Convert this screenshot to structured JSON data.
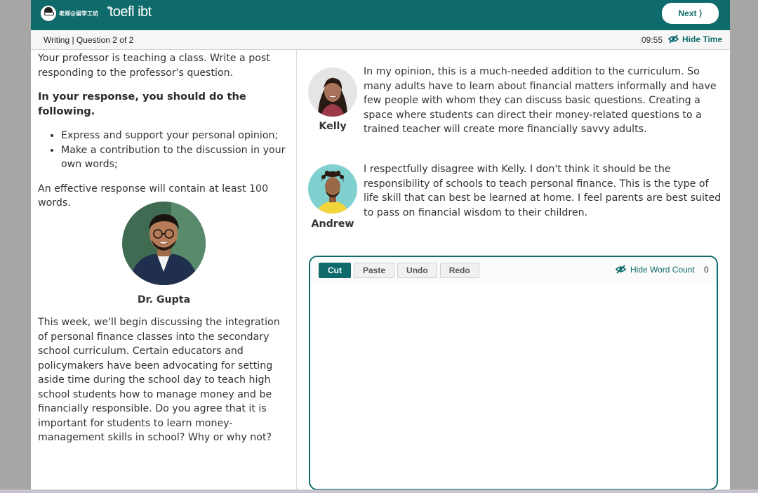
{
  "header": {
    "brand_text": "老郑@留学工坊",
    "logo_text": "toefl ibt",
    "next_label": "Next ⟩"
  },
  "subheader": {
    "section": "Writing | Question 2 of 2",
    "timer": "09:55",
    "hide_time_label": "Hide Time"
  },
  "prompt": {
    "intro": "Your professor is teaching a class. Write a post responding to the professor's question.",
    "requirements_heading": "In your response, you should do the following.",
    "requirements": [
      "Express and support your personal opinion;",
      "Make a contribution to the discussion in your own words;"
    ],
    "min_words": "An effective response will contain at least 100 words.",
    "professor_name": "Dr. Gupta",
    "professor_text": "This week, we'll begin discussing the integration of personal finance classes into the secondary school curriculum. Certain educators and policymakers have been advocating for setting aside time during the school day to teach high school students how to manage money and be financially responsible. Do you agree that it is important for students to learn money-management skills in school? Why or why not?"
  },
  "posts": [
    {
      "name": "Kelly",
      "text": "In my opinion, this is a much-needed addition to the curriculum. So many adults have to learn about financial matters informally and have few people with whom they can discuss basic questions. Creating a space where students can direct their money-related questions to a trained teacher will create more financially savvy adults."
    },
    {
      "name": "Andrew",
      "text": "I respectfully disagree with Kelly. I don't think it should be the responsibility of schools to teach personal finance. This is the type of life skill that can best be learned at home. I feel parents are best suited to pass on financial wisdom to their children."
    }
  ],
  "editor": {
    "buttons": [
      "Cut",
      "Paste",
      "Undo",
      "Redo"
    ],
    "hide_word_count_label": "Hide Word Count",
    "word_count": "0",
    "response_value": ""
  },
  "colors": {
    "teal": "#0f6b6b",
    "backdrop": "#a8a6a5"
  }
}
